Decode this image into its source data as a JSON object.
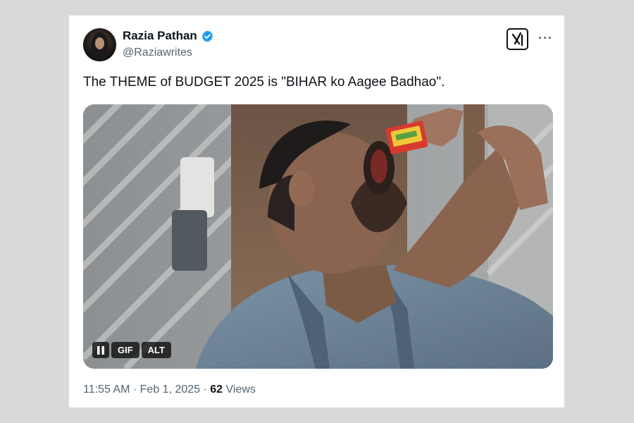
{
  "author": {
    "name": "Razia Pathan",
    "handle": "@Raziawrites",
    "verified": true,
    "badge_color": "#1d9bf0"
  },
  "toolbar": {
    "more_label": "···"
  },
  "tweet": {
    "text": "The THEME of BUDGET 2025 is \"BIHAR ko Aagee Badhao\"."
  },
  "media": {
    "type": "gif",
    "pause_icon": "pause-icon",
    "gif_label": "GIF",
    "alt_label": "ALT"
  },
  "footer": {
    "time": "11:55 AM",
    "sep1": " · ",
    "date": "Feb 1, 2025",
    "sep2": " · ",
    "views_count": "62",
    "views_label": " Views"
  },
  "colors": {
    "text_primary": "#0f1419",
    "text_secondary": "#536471",
    "background": "#d9d9d9",
    "card": "#ffffff"
  }
}
